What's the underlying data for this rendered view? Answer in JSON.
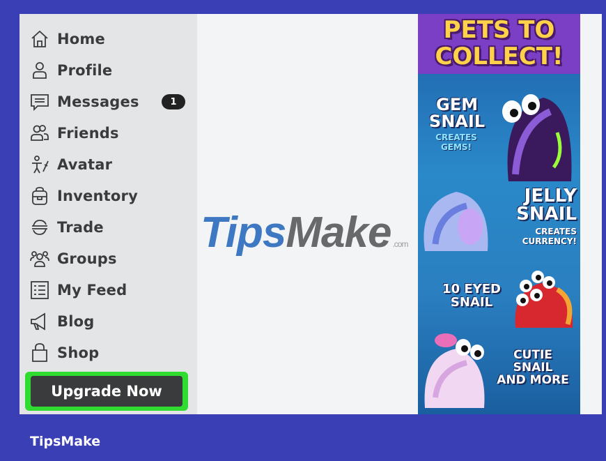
{
  "sidebar": {
    "items": [
      {
        "label": "Home",
        "icon": "home-icon"
      },
      {
        "label": "Profile",
        "icon": "profile-icon"
      },
      {
        "label": "Messages",
        "icon": "messages-icon",
        "badge": "1"
      },
      {
        "label": "Friends",
        "icon": "friends-icon"
      },
      {
        "label": "Avatar",
        "icon": "avatar-icon"
      },
      {
        "label": "Inventory",
        "icon": "inventory-icon"
      },
      {
        "label": "Trade",
        "icon": "trade-icon"
      },
      {
        "label": "Groups",
        "icon": "groups-icon"
      },
      {
        "label": "My Feed",
        "icon": "feed-icon"
      },
      {
        "label": "Blog",
        "icon": "blog-icon"
      },
      {
        "label": "Shop",
        "icon": "shop-icon"
      }
    ],
    "upgrade_label": "Upgrade Now"
  },
  "watermark": {
    "tips": "Tips",
    "make": "Make",
    "suffix": ".com"
  },
  "ad": {
    "title_line1": "PETS TO",
    "title_line2": "COLLECT!",
    "pets": [
      {
        "name_line1": "GEM",
        "name_line2": "SNAIL",
        "sub_line1": "CREATES",
        "sub_line2": "GEMS!"
      },
      {
        "name_line1": "JELLY",
        "name_line2": "SNAIL",
        "sub_line1": "CREATES",
        "sub_line2": "CURRENCY!"
      },
      {
        "name_line1": "10 EYED",
        "name_line2": "SNAIL"
      },
      {
        "name_line1": "CUTIE",
        "name_line2": "SNAIL",
        "name_line3": "AND MORE"
      }
    ]
  },
  "footer": {
    "brand": "TipsMake"
  },
  "colors": {
    "frame_border": "#3b3fb6",
    "sidebar_bg": "#e3e5e7",
    "upgrade_highlight": "#2fdc2f",
    "ad_header": "#7b3fc6"
  }
}
